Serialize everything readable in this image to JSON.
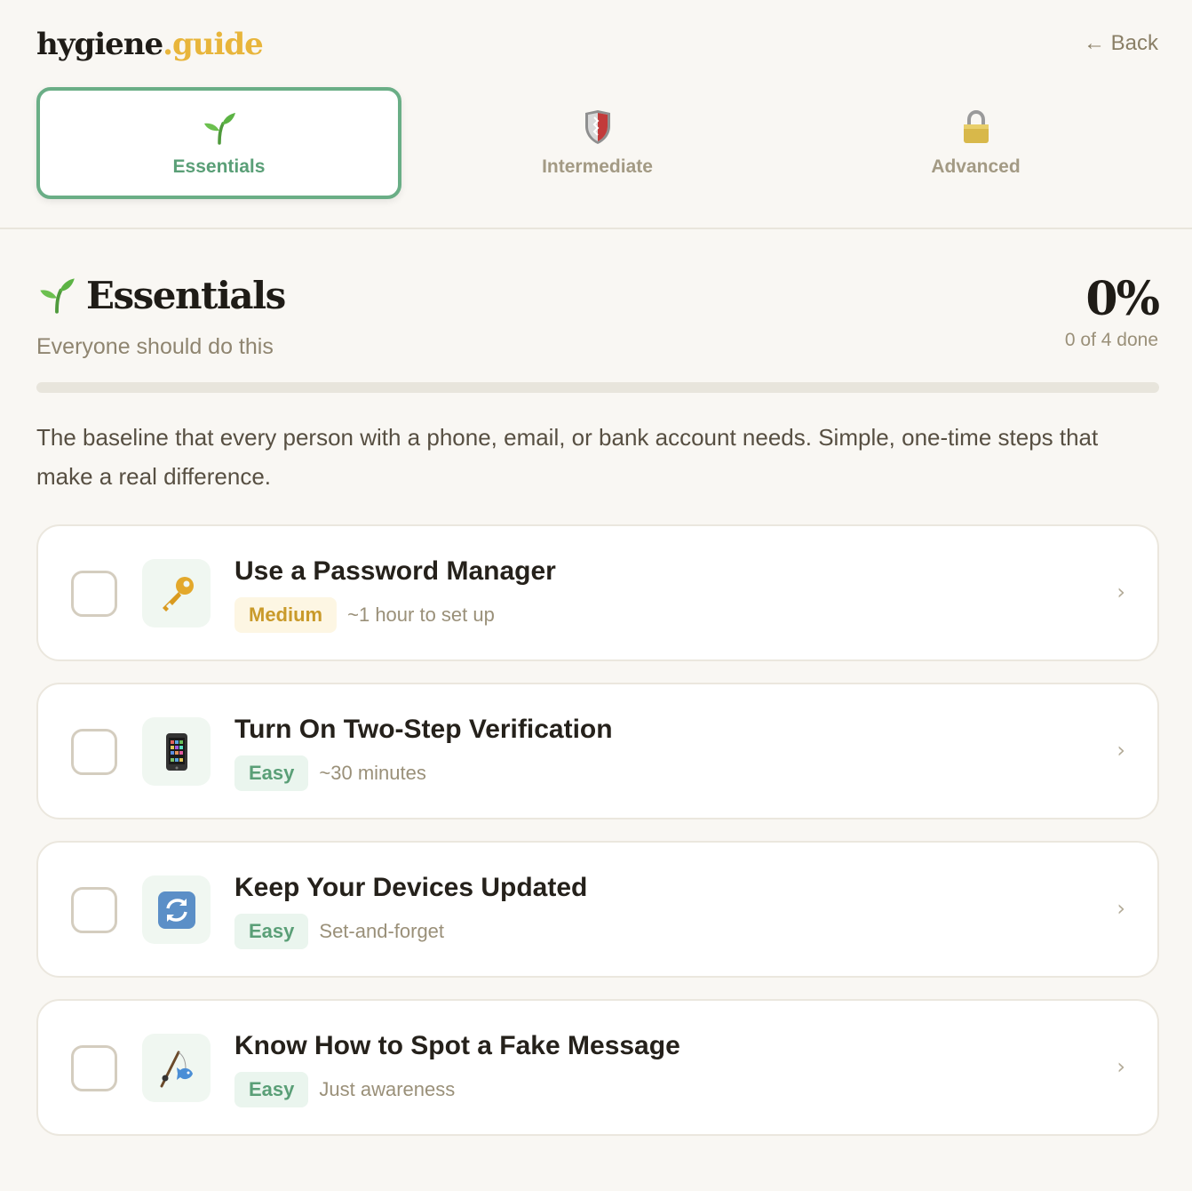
{
  "app": {
    "logo_main": "hygiene",
    "logo_accent": ".guide",
    "back_label": "← Back"
  },
  "tabs": [
    {
      "label": "Essentials",
      "icon": "sprout-icon",
      "active": true
    },
    {
      "label": "Intermediate",
      "icon": "shield-icon",
      "active": false
    },
    {
      "label": "Advanced",
      "icon": "lock-icon",
      "active": false
    }
  ],
  "section": {
    "title": "Essentials",
    "subtitle": "Everyone should do this",
    "percent_label": "0%",
    "done_label": "0 of 4 done",
    "progress_fraction": 0,
    "description": "The baseline that every person with a phone, email, or bank account needs. Simple, one-time steps that make a real difference."
  },
  "tasks": [
    {
      "title": "Use a Password Manager",
      "difficulty": "Medium",
      "time": "~1 hour to set up",
      "icon": "key-icon",
      "checked": false
    },
    {
      "title": "Turn On Two-Step Verification",
      "difficulty": "Easy",
      "time": "~30 minutes",
      "icon": "phone-icon",
      "checked": false
    },
    {
      "title": "Keep Your Devices Updated",
      "difficulty": "Easy",
      "time": "Set-and-forget",
      "icon": "refresh-icon",
      "checked": false
    },
    {
      "title": "Know How to Spot a Fake Message",
      "difficulty": "Easy",
      "time": "Just awareness",
      "icon": "fishing-pole-icon",
      "checked": false
    }
  ],
  "colors": {
    "accent_green": "#6aae86",
    "accent_yellow": "#e8b53b",
    "background": "#f9f7f3"
  }
}
